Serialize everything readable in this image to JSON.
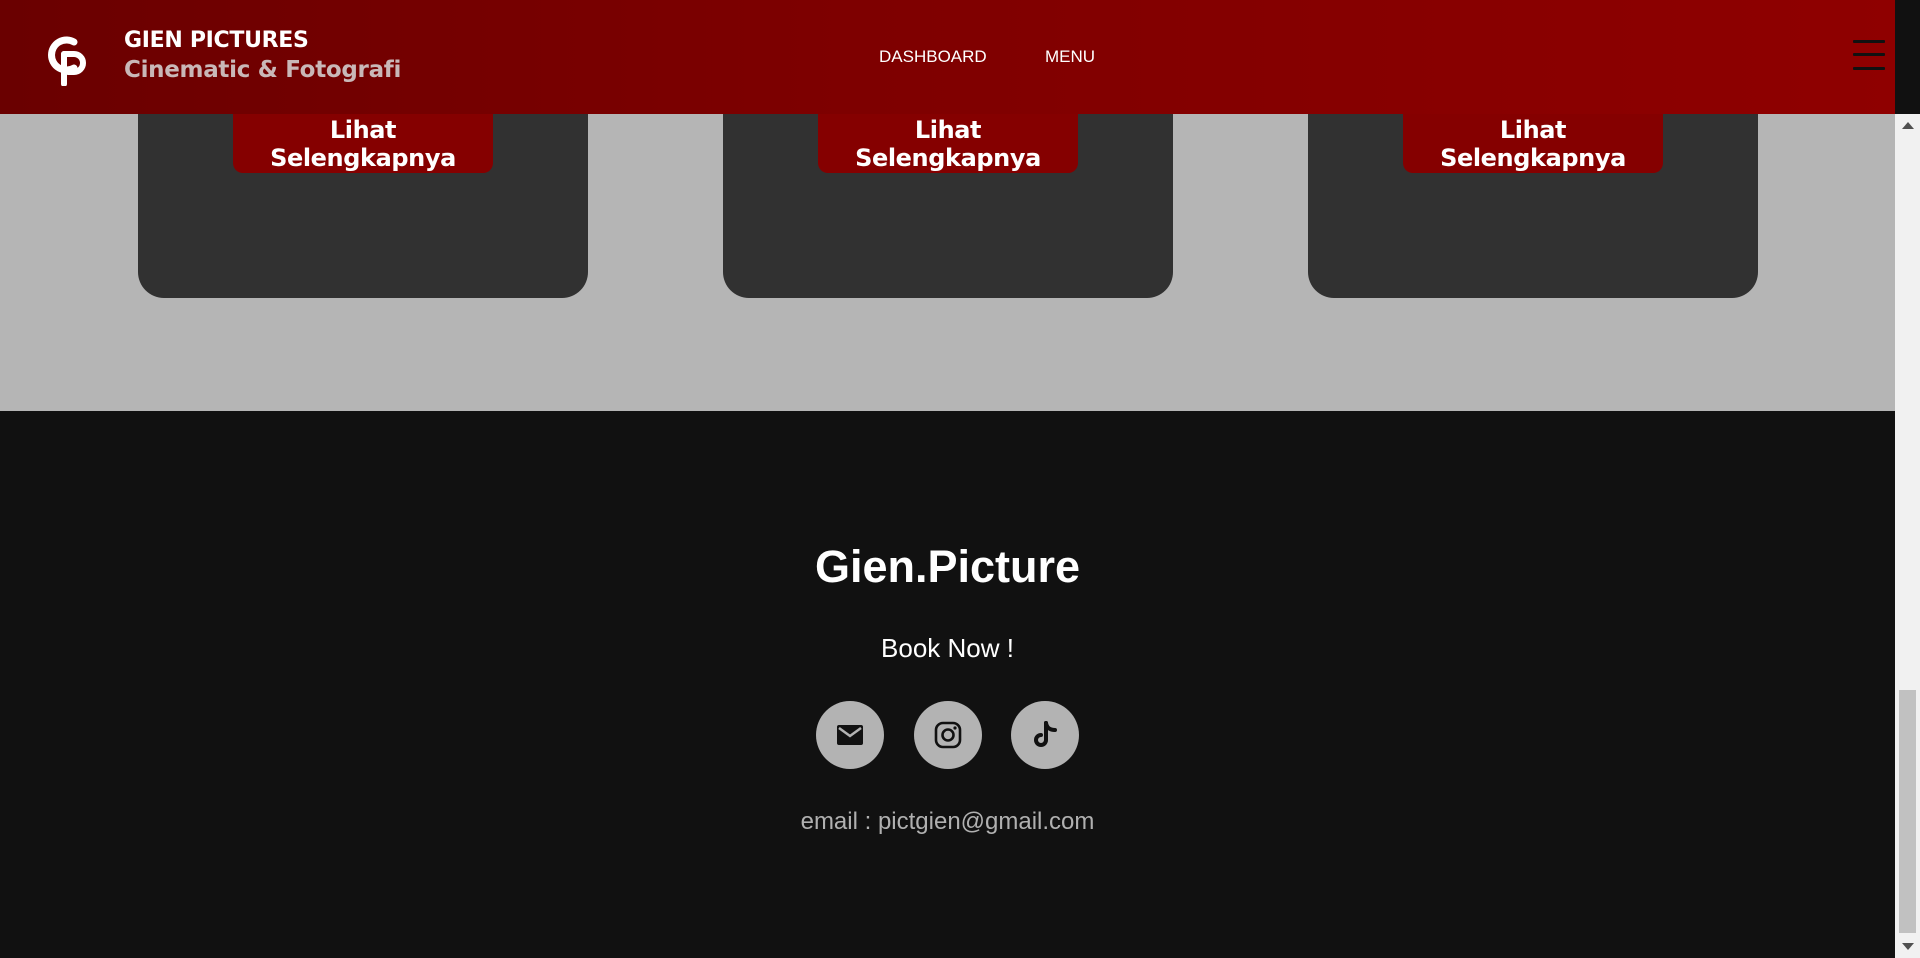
{
  "navbar": {
    "logo_alt": "GP",
    "brand_title": "GIEN PICTURES",
    "brand_subtitle": "Cinematic & Fotografi",
    "links": [
      {
        "label": "DASHBOARD"
      },
      {
        "label": "MENU"
      }
    ],
    "menu_icon": "hamburger-icon",
    "colors": {
      "gradient_start": "#6a0000",
      "gradient_end": "#8f0000"
    }
  },
  "gallery": {
    "cards": [
      {
        "button_label": "Lihat Selengkapnya"
      },
      {
        "button_label": "Lihat Selengkapnya"
      },
      {
        "button_label": "Lihat Selengkapnya"
      }
    ],
    "colors": {
      "background": "#b5b5b5",
      "card": "#313131",
      "button": "#850000"
    }
  },
  "footer": {
    "title": "Gien.Picture",
    "cta": "Book Now !",
    "social": [
      {
        "icon": "mail-icon"
      },
      {
        "icon": "instagram-icon"
      },
      {
        "icon": "tiktok-icon"
      }
    ],
    "email": "email : pictgien@gmail.com",
    "colors": {
      "background": "#111111",
      "social_bg": "#b3b3b3"
    }
  }
}
